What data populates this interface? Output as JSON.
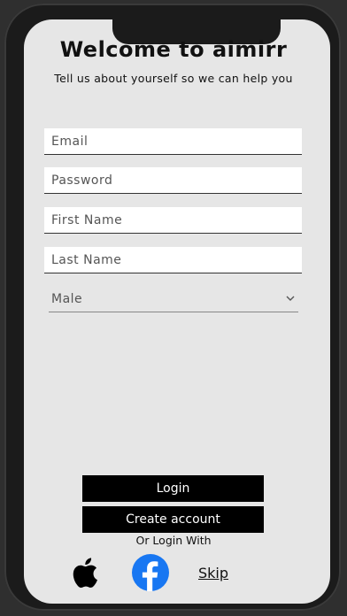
{
  "header": {
    "title": "Welcome to aimirr",
    "subtitle": "Tell us about yourself so we can help you"
  },
  "form": {
    "email_placeholder": "Email",
    "password_placeholder": "Password",
    "first_name_placeholder": "First Name",
    "last_name_placeholder": "Last Name",
    "gender_selected": "Male"
  },
  "actions": {
    "login_label": "Login",
    "create_account_label": "Create account",
    "or_login_with": "Or Login With",
    "skip_label": "Skip"
  },
  "icons": {
    "apple": "apple-icon",
    "facebook": "facebook-icon",
    "chevron": "chevron-down-icon"
  },
  "colors": {
    "screen_bg": "#e6e6e6",
    "button_bg": "#000000",
    "facebook_blue": "#1877f2"
  }
}
